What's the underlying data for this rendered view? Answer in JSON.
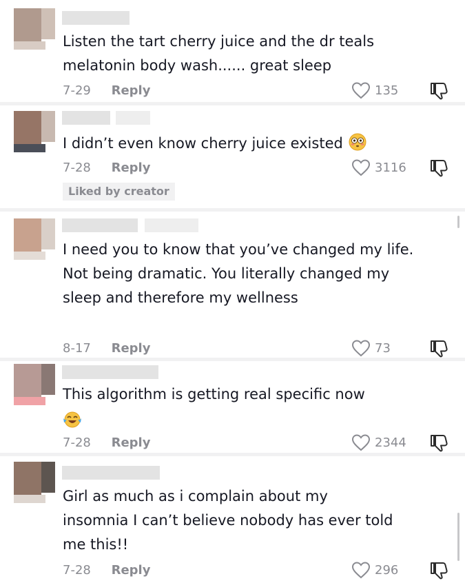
{
  "comments": [
    {
      "text": "Listen the tart cherry juice and the dr teals melatonin body wash...... great sleep",
      "date": "7-29",
      "reply": "Reply",
      "likes": "135",
      "avatar": [
        "#b09a8e",
        "#cfc0b6",
        "#d8ccc4"
      ]
    },
    {
      "text": "I didn’t even know cherry juice existed",
      "emoji": "flushed-face-emoji",
      "date": "7-28",
      "reply": "Reply",
      "likes": "3116",
      "badge": "Liked by creator",
      "avatar": [
        "#967566",
        "#c8b9b0",
        "#4a4e58"
      ]
    },
    {
      "text": "I need you to know that you’ve changed my life. Not being dramatic. You literally changed my sleep and therefore my wellness",
      "date": "8-17",
      "reply": "Reply",
      "likes": "73",
      "avatar": [
        "#c8a28e",
        "#d9cfc8",
        "#e4dcd6"
      ]
    },
    {
      "text": "This algorithm is getting real specific now",
      "emoji": "face-with-tears-of-joy-emoji",
      "date": "7-28",
      "reply": "Reply",
      "likes": "2344",
      "avatar": [
        "#b79a95",
        "#8a7874",
        "#f0a2a6"
      ]
    },
    {
      "text": "Girl as much as i complain about my insomnia I can’t believe nobody has ever told me this!!",
      "date": "7-28",
      "reply": "Reply",
      "likes": "296",
      "avatar": [
        "#8f7466",
        "#5d5550",
        "#ded6d0"
      ]
    }
  ]
}
